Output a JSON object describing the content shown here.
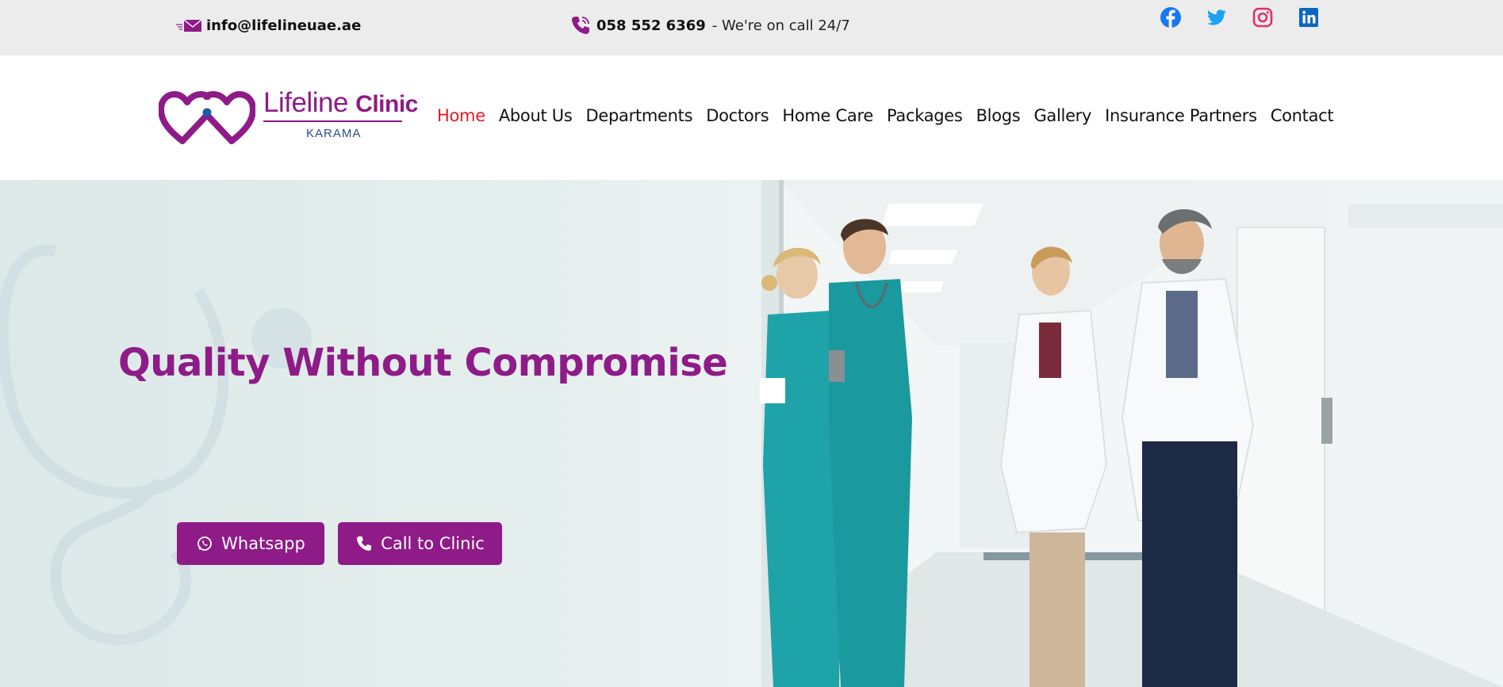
{
  "topbar": {
    "email": "info@lifelineuae.ae",
    "phone": "058 552 6369",
    "phone_note": "- We're on call 24/7",
    "social": [
      {
        "icon": "facebook-icon",
        "color": "#1877f2"
      },
      {
        "icon": "twitter-icon",
        "color": "#1da1f2"
      },
      {
        "icon": "instagram-icon",
        "color": "#e1306c"
      },
      {
        "icon": "linkedin-icon",
        "color": "#0a66c2"
      }
    ]
  },
  "logo": {
    "name_light": "Lifeline",
    "name_bold": "Clinic",
    "location": "KARAMA"
  },
  "nav": {
    "items": [
      "Home",
      "About Us",
      "Departments",
      "Doctors",
      "Home Care",
      "Packages",
      "Blogs",
      "Gallery",
      "Insurance Partners",
      "Contact"
    ],
    "active": "Home"
  },
  "hero": {
    "title": "Quality Without Compromise",
    "whatsapp_label": "Whatsapp",
    "call_label": "Call to Clinic"
  },
  "colors": {
    "brand": "#8e1b87",
    "active_nav": "#e21b23",
    "topbar_bg": "#ececec",
    "scrubs": "#1ea3a8"
  }
}
